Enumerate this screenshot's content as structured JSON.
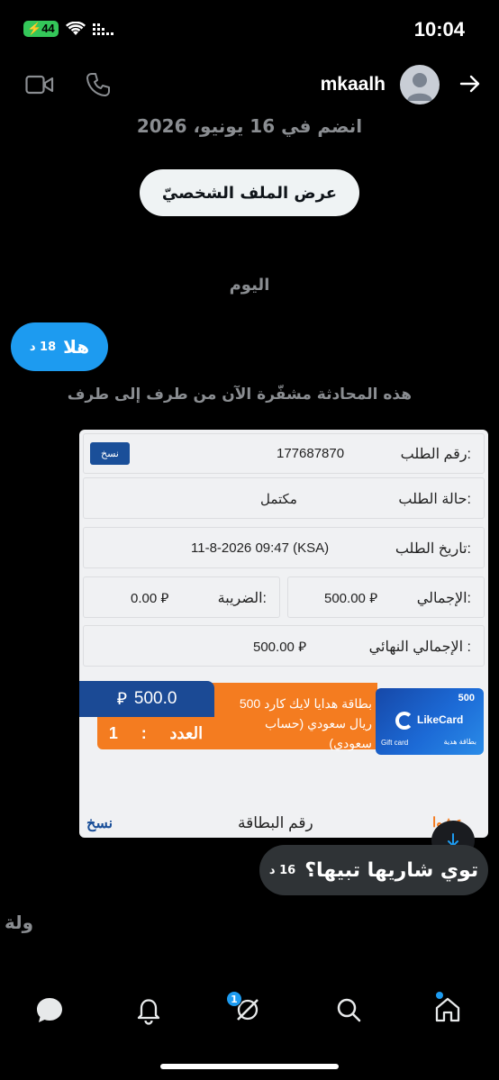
{
  "status_bar": {
    "time": "10:04",
    "battery": "44",
    "icons": [
      "battery-charging-icon",
      "wifi-icon",
      "signal-icon"
    ]
  },
  "header": {
    "username": "mkaalh",
    "joined": "انضم في 16 يونيو، 2026",
    "profile_button": "عرض الملف الشخصيّ",
    "icons": [
      "video-call-icon",
      "phone-icon",
      "avatar",
      "back-arrow-icon"
    ]
  },
  "conversation": {
    "day_separator": "اليوم",
    "encryption_notice": "هذه المحادثة مشفّرة الآن من طرف إلى طرف",
    "messages": [
      {
        "text": "هلا",
        "time": "18 د",
        "sender": "self"
      },
      {
        "text": "توي شاريها تبيها؟",
        "time": "16 د",
        "sender": "other"
      }
    ],
    "partial_text": "ولة"
  },
  "order_card": {
    "order_number_label": "رقم الطلب:",
    "order_number": "177687870",
    "copy_label": "نسخ",
    "status_label": "حالة الطلب:",
    "status": "مكتمل",
    "date_label": "تاريخ الطلب:",
    "date": "11-8-2026 09:47 (KSA)",
    "total_label": "الإجمالي:",
    "total": "500.00",
    "tax_label": "الضريبة:",
    "tax": "0.00",
    "final_total_label": "الإجمالي النهائي :",
    "final_total": "500.00",
    "product": {
      "name_line1": "بطاقة هدايا لايك كارد 500",
      "name_line2": "ريال سعودي (حساب سعودي)",
      "price": "500.0",
      "count_label": "العدد",
      "count_sep": ":",
      "count": "1",
      "image_value": "500",
      "image_brand": "LikeCard",
      "image_caption_en": "Gift card",
      "image_caption_ar": "بطاقة هدية"
    },
    "card_number_label": "رقم البطاقة",
    "copy_link": "نسخ",
    "partial_link": "عشوا"
  },
  "bottom_nav": {
    "items": [
      "home-icon",
      "search-icon",
      "grok-icon",
      "notifications-icon",
      "messages-icon"
    ],
    "badge": "1"
  },
  "colors": {
    "background": "#000000",
    "accent": "#1d9bf0",
    "orange": "#f47c20",
    "navy": "#1b4a95"
  }
}
